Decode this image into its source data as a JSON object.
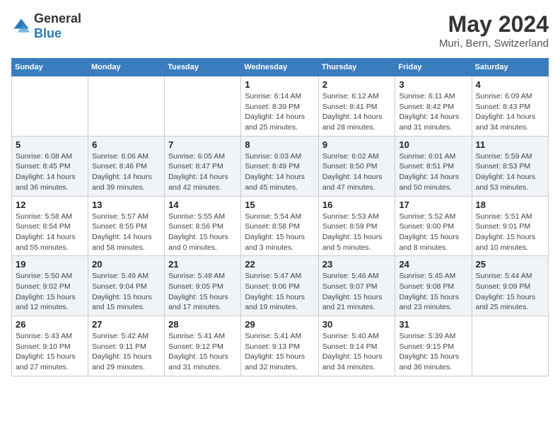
{
  "header": {
    "logo_general": "General",
    "logo_blue": "Blue",
    "main_title": "May 2024",
    "subtitle": "Muri, Bern, Switzerland"
  },
  "days_of_week": [
    "Sunday",
    "Monday",
    "Tuesday",
    "Wednesday",
    "Thursday",
    "Friday",
    "Saturday"
  ],
  "weeks": [
    [
      {
        "day": "",
        "sunrise": "",
        "sunset": "",
        "daylight": ""
      },
      {
        "day": "",
        "sunrise": "",
        "sunset": "",
        "daylight": ""
      },
      {
        "day": "",
        "sunrise": "",
        "sunset": "",
        "daylight": ""
      },
      {
        "day": "1",
        "sunrise": "6:14 AM",
        "sunset": "8:39 PM",
        "daylight": "14 hours and 25 minutes."
      },
      {
        "day": "2",
        "sunrise": "6:12 AM",
        "sunset": "8:41 PM",
        "daylight": "14 hours and 28 minutes."
      },
      {
        "day": "3",
        "sunrise": "6:11 AM",
        "sunset": "8:42 PM",
        "daylight": "14 hours and 31 minutes."
      },
      {
        "day": "4",
        "sunrise": "6:09 AM",
        "sunset": "8:43 PM",
        "daylight": "14 hours and 34 minutes."
      }
    ],
    [
      {
        "day": "5",
        "sunrise": "6:08 AM",
        "sunset": "8:45 PM",
        "daylight": "14 hours and 36 minutes."
      },
      {
        "day": "6",
        "sunrise": "6:06 AM",
        "sunset": "8:46 PM",
        "daylight": "14 hours and 39 minutes."
      },
      {
        "day": "7",
        "sunrise": "6:05 AM",
        "sunset": "8:47 PM",
        "daylight": "14 hours and 42 minutes."
      },
      {
        "day": "8",
        "sunrise": "6:03 AM",
        "sunset": "8:49 PM",
        "daylight": "14 hours and 45 minutes."
      },
      {
        "day": "9",
        "sunrise": "6:02 AM",
        "sunset": "8:50 PM",
        "daylight": "14 hours and 47 minutes."
      },
      {
        "day": "10",
        "sunrise": "6:01 AM",
        "sunset": "8:51 PM",
        "daylight": "14 hours and 50 minutes."
      },
      {
        "day": "11",
        "sunrise": "5:59 AM",
        "sunset": "8:53 PM",
        "daylight": "14 hours and 53 minutes."
      }
    ],
    [
      {
        "day": "12",
        "sunrise": "5:58 AM",
        "sunset": "8:54 PM",
        "daylight": "14 hours and 55 minutes."
      },
      {
        "day": "13",
        "sunrise": "5:57 AM",
        "sunset": "8:55 PM",
        "daylight": "14 hours and 58 minutes."
      },
      {
        "day": "14",
        "sunrise": "5:55 AM",
        "sunset": "8:56 PM",
        "daylight": "15 hours and 0 minutes."
      },
      {
        "day": "15",
        "sunrise": "5:54 AM",
        "sunset": "8:58 PM",
        "daylight": "15 hours and 3 minutes."
      },
      {
        "day": "16",
        "sunrise": "5:53 AM",
        "sunset": "8:59 PM",
        "daylight": "15 hours and 5 minutes."
      },
      {
        "day": "17",
        "sunrise": "5:52 AM",
        "sunset": "9:00 PM",
        "daylight": "15 hours and 8 minutes."
      },
      {
        "day": "18",
        "sunrise": "5:51 AM",
        "sunset": "9:01 PM",
        "daylight": "15 hours and 10 minutes."
      }
    ],
    [
      {
        "day": "19",
        "sunrise": "5:50 AM",
        "sunset": "9:02 PM",
        "daylight": "15 hours and 12 minutes."
      },
      {
        "day": "20",
        "sunrise": "5:49 AM",
        "sunset": "9:04 PM",
        "daylight": "15 hours and 15 minutes."
      },
      {
        "day": "21",
        "sunrise": "5:48 AM",
        "sunset": "9:05 PM",
        "daylight": "15 hours and 17 minutes."
      },
      {
        "day": "22",
        "sunrise": "5:47 AM",
        "sunset": "9:06 PM",
        "daylight": "15 hours and 19 minutes."
      },
      {
        "day": "23",
        "sunrise": "5:46 AM",
        "sunset": "9:07 PM",
        "daylight": "15 hours and 21 minutes."
      },
      {
        "day": "24",
        "sunrise": "5:45 AM",
        "sunset": "9:08 PM",
        "daylight": "15 hours and 23 minutes."
      },
      {
        "day": "25",
        "sunrise": "5:44 AM",
        "sunset": "9:09 PM",
        "daylight": "15 hours and 25 minutes."
      }
    ],
    [
      {
        "day": "26",
        "sunrise": "5:43 AM",
        "sunset": "9:10 PM",
        "daylight": "15 hours and 27 minutes."
      },
      {
        "day": "27",
        "sunrise": "5:42 AM",
        "sunset": "9:11 PM",
        "daylight": "15 hours and 29 minutes."
      },
      {
        "day": "28",
        "sunrise": "5:41 AM",
        "sunset": "9:12 PM",
        "daylight": "15 hours and 31 minutes."
      },
      {
        "day": "29",
        "sunrise": "5:41 AM",
        "sunset": "9:13 PM",
        "daylight": "15 hours and 32 minutes."
      },
      {
        "day": "30",
        "sunrise": "5:40 AM",
        "sunset": "9:14 PM",
        "daylight": "15 hours and 34 minutes."
      },
      {
        "day": "31",
        "sunrise": "5:39 AM",
        "sunset": "9:15 PM",
        "daylight": "15 hours and 36 minutes."
      },
      {
        "day": "",
        "sunrise": "",
        "sunset": "",
        "daylight": ""
      }
    ]
  ],
  "labels": {
    "sunrise_prefix": "Sunrise: ",
    "sunset_prefix": "Sunset: ",
    "daylight_prefix": "Daylight: "
  }
}
